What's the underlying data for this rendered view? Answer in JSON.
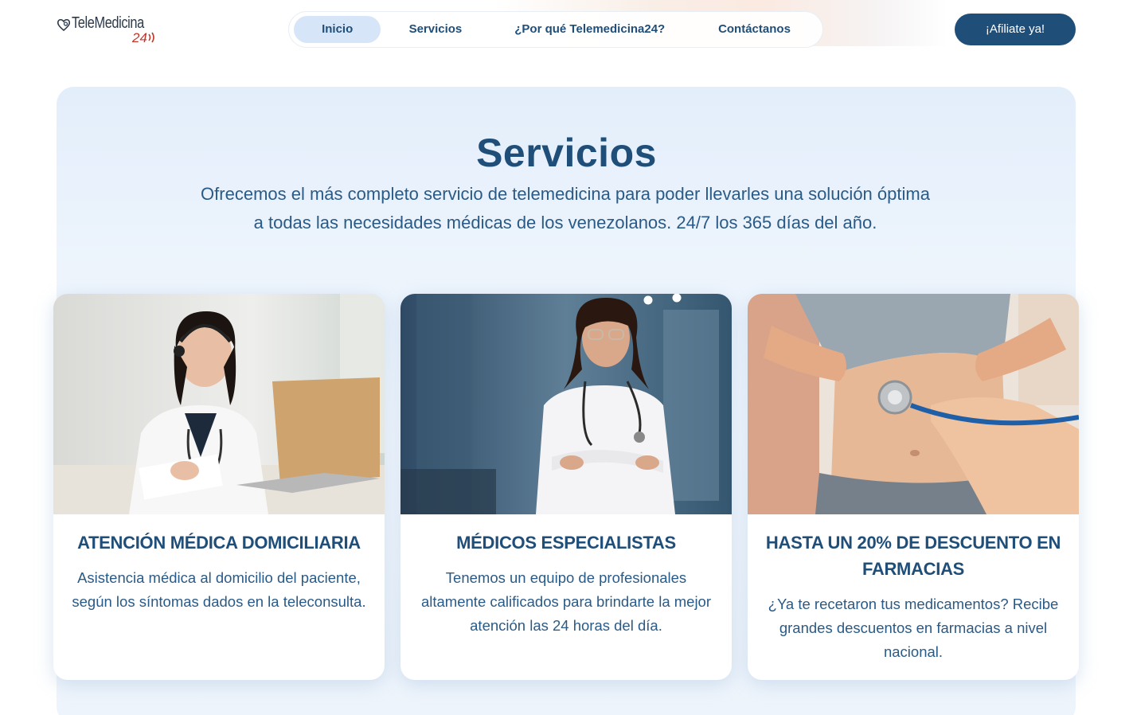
{
  "brand": {
    "logo_text": "TeleMedicina",
    "logo_number": "24"
  },
  "nav": {
    "items": [
      {
        "label": "Inicio",
        "active": true
      },
      {
        "label": "Servicios",
        "active": false
      },
      {
        "label": "¿Por qué Telemedicina24?",
        "active": false
      },
      {
        "label": "Contáctanos",
        "active": false
      }
    ]
  },
  "cta": {
    "label": "¡Afiliate ya!"
  },
  "services": {
    "title": "Servicios",
    "description": "Ofrecemos el más completo servicio de telemedicina para poder llevarles una solución óptima a todas las necesidades médicas de los venezolanos. 24/7 los 365 días del año.",
    "cards": [
      {
        "title": "ATENCIÓN MÉDICA DOMICILIARIA",
        "text": "Asistencia médica al domicilio del paciente, según los síntomas dados en la teleconsulta."
      },
      {
        "title": "MÉDICOS ESPECIALISTAS",
        "text": "Tenemos un equipo de profesionales altamente calificados para brindarte la mejor atención las 24 horas del día."
      },
      {
        "title": "HASTA UN 20% DE DESCUENTO EN FARMACIAS",
        "text": "¿Ya te recetaron tus medicamentos? Recibe grandes descuentos en farmacias a nivel nacional."
      }
    ]
  },
  "colors": {
    "brand_blue": "#1f4e79",
    "nav_active": "#d6e6f8",
    "accent_red": "#c0392b",
    "section_bg": "#e3eefb"
  },
  "icons": [
    "stethoscope-heart-icon",
    "signal-waves-icon"
  ]
}
